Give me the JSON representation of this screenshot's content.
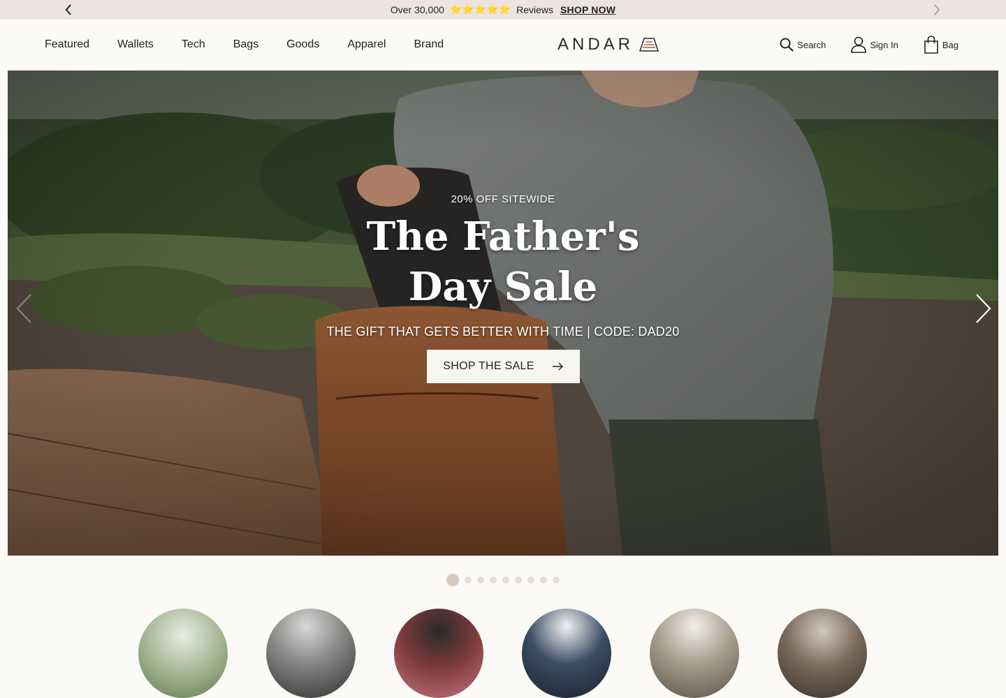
{
  "announcement": {
    "text": "Over 30,000",
    "stars": "⭐⭐⭐⭐⭐",
    "reviews": "Reviews",
    "link": "SHOP NOW",
    "prev_icon": "chevron-left-icon",
    "next_icon": "chevron-right-icon"
  },
  "nav": {
    "items": [
      "Featured",
      "Wallets",
      "Tech",
      "Bags",
      "Goods",
      "Apparel",
      "Brand"
    ]
  },
  "logo": {
    "text": "ANDAR"
  },
  "utilities": {
    "search": "Search",
    "sign_in": "Sign In",
    "bag": "Bag"
  },
  "hero": {
    "kicker": "20% OFF SITEWIDE",
    "headline": "The Father's Day Sale",
    "subheadline": "THE GIFT THAT GETS BETTER WITH TIME | CODE: DAD20",
    "cta_label": "SHOP THE SALE",
    "slide_count": 9,
    "active_slide": 1
  },
  "colors": {
    "announcement_bg": "#ece4e0",
    "page_bg": "#fbfaf7",
    "star": "#f5b800",
    "logo_accent": "#b58d73",
    "cta_bg": "#f7f5f0",
    "dot_active": "#d7c9bd",
    "dot": "#e2ddd7"
  }
}
